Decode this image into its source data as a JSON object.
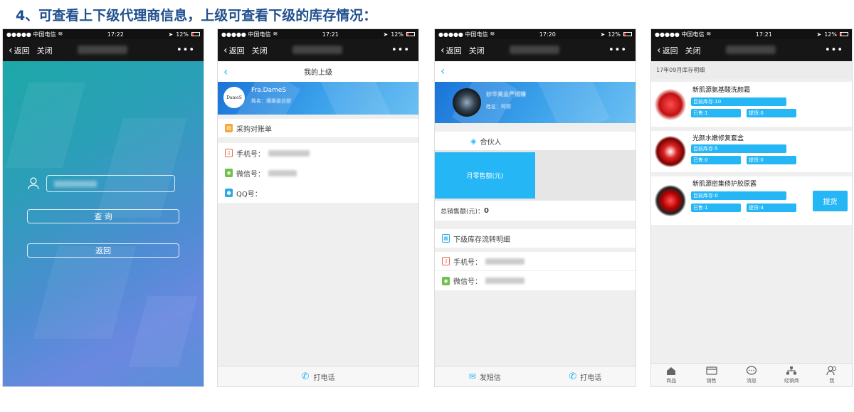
{
  "title": "4、可查看上下级代理商信息，上级可查看下级的库存情况：",
  "status": {
    "carrier": "●●●●● 中国电信",
    "wifi": "wifi-icon",
    "battery": "12%",
    "times": [
      "17:22",
      "17:21",
      "17:20",
      "17:21"
    ]
  },
  "nav": {
    "back": "返回",
    "close": "关闭",
    "more": "•••"
  },
  "phone1": {
    "query": "查 询",
    "back_btn": "返回"
  },
  "phone2": {
    "header": "我的上级",
    "name": "Fra.DameS",
    "name_label": "姓名：",
    "name_value": "爆美姿总部",
    "logo_text": "DameS",
    "purchase": "采购对账单",
    "phone_label": "手机号：",
    "wechat_label": "微信号：",
    "qq_label": "QQ号：",
    "call": "打电话"
  },
  "phone3": {
    "org": "妙华美业严措赚",
    "name_label": "姓名：",
    "name_value": "阿郭",
    "partner": "合伙人",
    "monthly_sales": "月零售额(元)",
    "total_sales_label": "总销售额(元)：",
    "total_sales_value": "0",
    "stock_flow": "下级库存流转明细",
    "phone_label": "手机号：",
    "wechat_label": "微信号：",
    "sms": "发短信",
    "call": "打电话"
  },
  "phone4": {
    "month_header": "17年09月库存明细",
    "products": [
      {
        "name": "新肌源氨基酸洗颜霜",
        "stock": "目前库存:10",
        "sold": "已售:1",
        "picked": "提货:0"
      },
      {
        "name": "光颜水嫩修复套盒",
        "stock": "目前库存:5",
        "sold": "已售:0",
        "picked": "提货:0"
      },
      {
        "name": "新肌源密集修护胶原露",
        "stock": "目前库存:0",
        "sold": "已售:1",
        "picked": "提货:4"
      }
    ],
    "pickup_btn": "提货",
    "tabs": [
      "商品",
      "销售",
      "消息",
      "经销商",
      "我"
    ]
  },
  "colors": {
    "accent": "#24b6f5",
    "title": "#1f4f8e",
    "navbar": "#161616"
  }
}
